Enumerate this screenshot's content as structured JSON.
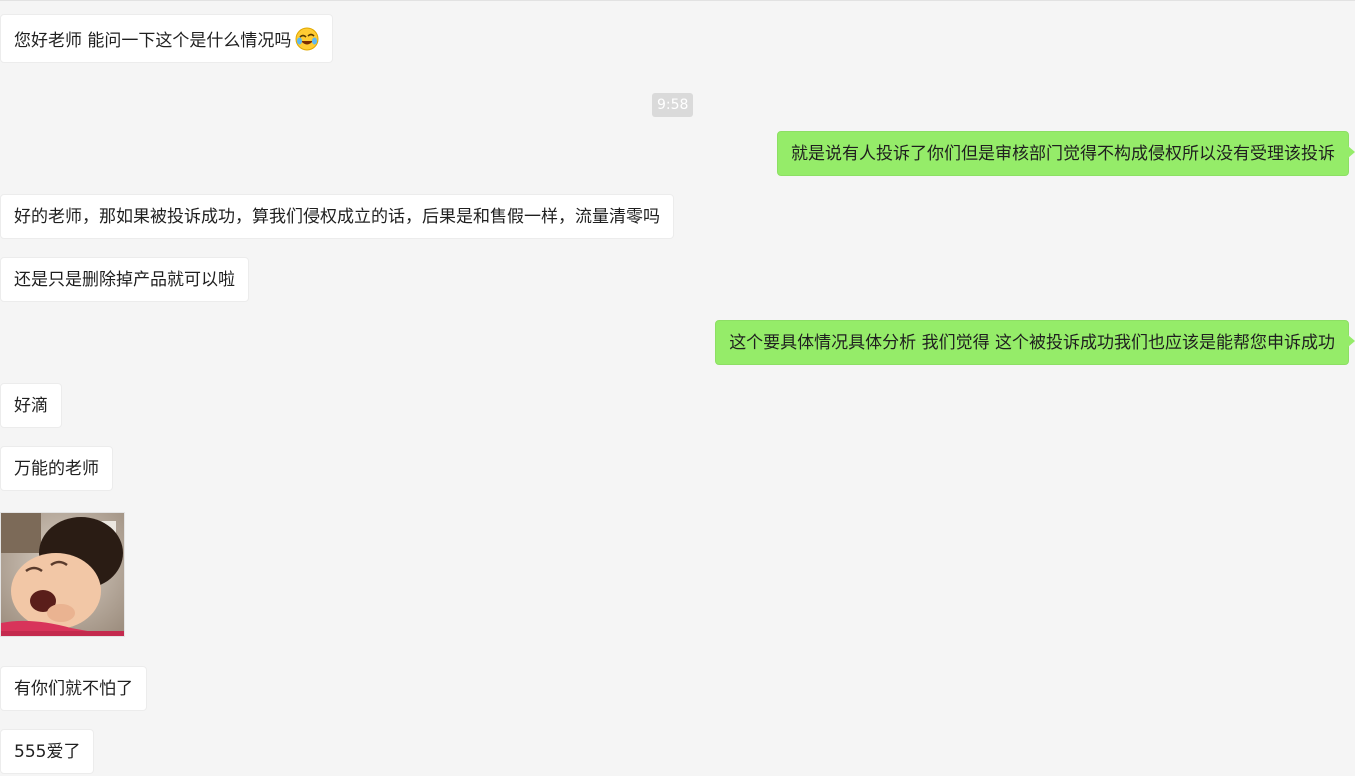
{
  "messages": [
    {
      "id": "m1",
      "side": "in",
      "text": "您好老师 能问一下这个是什么情况吗",
      "emoji": "laughing-crying-emoji"
    },
    {
      "id": "t1",
      "type": "time",
      "text": "9:58"
    },
    {
      "id": "m2",
      "side": "out",
      "text": "就是说有人投诉了你们但是审核部门觉得不构成侵权所以没有受理该投诉"
    },
    {
      "id": "m3",
      "side": "in",
      "text": "好的老师，那如果被投诉成功，算我们侵权成立的话，后果是和售假一样，流量清零吗"
    },
    {
      "id": "m4",
      "side": "in",
      "text": "还是只是删除掉产品就可以啦"
    },
    {
      "id": "m5",
      "side": "out",
      "text": "这个要具体情况具体分析 我们觉得 这个被投诉成功我们也应该是能帮您申诉成功"
    },
    {
      "id": "m6",
      "side": "in",
      "text": "好滴"
    },
    {
      "id": "m7",
      "side": "in",
      "text": "万能的老师"
    },
    {
      "id": "m8",
      "side": "in",
      "type": "sticker",
      "sticker": "laughing-baby-sticker"
    },
    {
      "id": "m9",
      "side": "in",
      "text": "有你们就不怕了"
    },
    {
      "id": "m10",
      "side": "in",
      "text": "555爱了"
    }
  ],
  "colors": {
    "background": "#f5f5f5",
    "incoming_bubble": "#ffffff",
    "outgoing_bubble": "#95ec69",
    "time_label_bg": "#dadada"
  }
}
